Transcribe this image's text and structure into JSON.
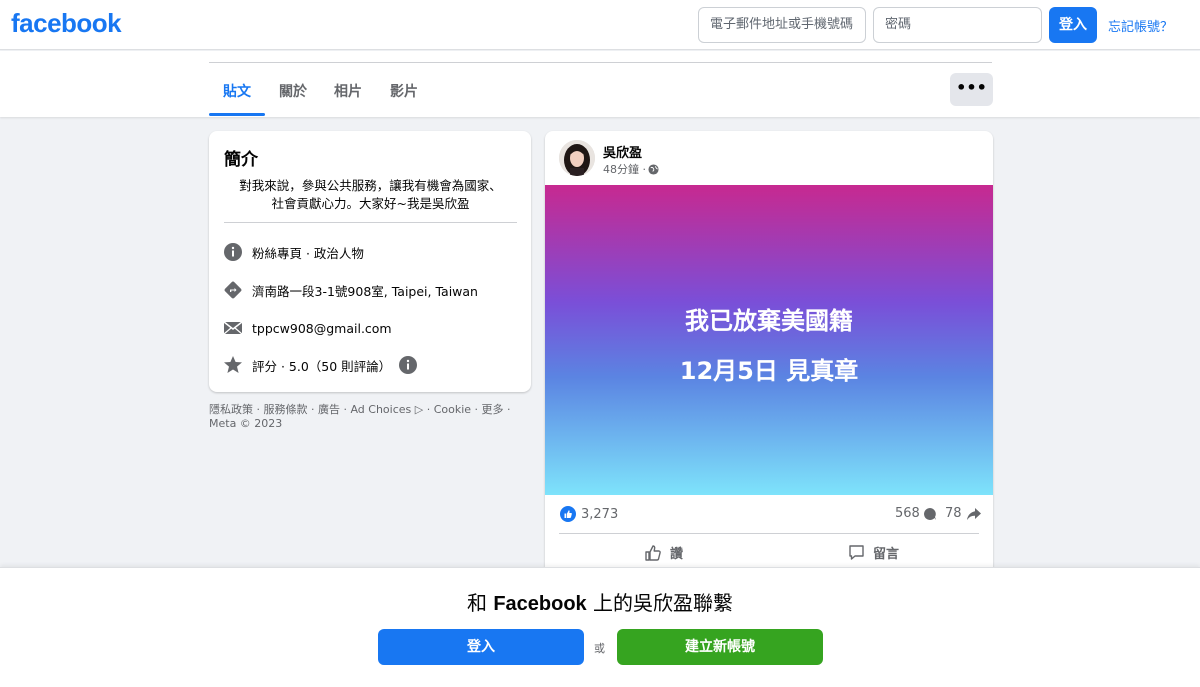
{
  "header": {
    "logo": "facebook",
    "email_placeholder": "電子郵件地址或手機號碼",
    "password_placeholder": "密碼",
    "login_label": "登入",
    "forgot_label": "忘記帳號？"
  },
  "tabs": [
    {
      "label": "貼文",
      "active": true
    },
    {
      "label": "關於",
      "active": false
    },
    {
      "label": "相片",
      "active": false
    },
    {
      "label": "影片",
      "active": false
    }
  ],
  "more_label": "•••",
  "intro": {
    "title": "簡介",
    "bio_line1": "對我來說，參與公共服務，讓我有機會為國家、",
    "bio_line2": "社會貢獻心力。大家好~我是吳欣盈",
    "items": [
      {
        "icon": "info-icon",
        "text": "粉絲專頁 · 政治人物"
      },
      {
        "icon": "directions-icon",
        "text": "濟南路一段3-1號908室, Taipei, Taiwan"
      },
      {
        "icon": "mail-icon",
        "text": "tppcw908@gmail.com"
      },
      {
        "icon": "star-icon",
        "text": "評分 · 5.0（50 則評論）"
      }
    ]
  },
  "footer": {
    "line1": "隱私政策 · 服務條款 · 廣告 · Ad Choices ▷ · Cookie · 更多 ·",
    "line2": "Meta © 2023"
  },
  "post": {
    "author": "吳欣盈",
    "time": "48分鐘 ·",
    "image_line1": "我已放棄美國籍",
    "image_line2": "12月5日 見真章",
    "likes": "3,273",
    "comments": "568",
    "shares": "78",
    "like_label": "讚",
    "comment_label": "留言"
  },
  "connect": {
    "title_prefix": "和 ",
    "title_brand": "Facebook",
    "title_suffix": " 上的吳欣盈聯繫",
    "login_label": "登入",
    "or_label": "或",
    "create_label": "建立新帳號"
  },
  "colors": {
    "brand": "#1877f2",
    "create": "#36a420"
  }
}
